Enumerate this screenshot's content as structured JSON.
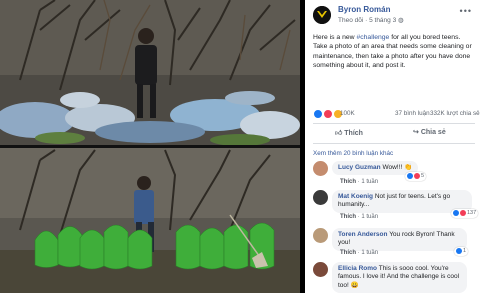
{
  "post": {
    "author": "Byron Román",
    "follow_label": "Theo dõi",
    "date": "5 tháng 3",
    "text_before": "Here is a new ",
    "hashtag": "#challenge",
    "text_after": " for all you bored teens. Take a photo of an area that needs some cleaning or maintenance, then take a photo after you have done something about it, and post it.",
    "reaction_count": "100K",
    "comments_count": "37 bình luận",
    "shares_count": "332K lượt chia sẻ",
    "like_label": "Thích",
    "share_label": "Chia sẻ",
    "more_comments": "Xem thêm 20 bình luận khác"
  },
  "comments": [
    {
      "name": "Lucy Guzman",
      "text": "Wow!!! 👏",
      "like": "Thích",
      "time": "1 tuần",
      "badge": "5"
    },
    {
      "name": "Mat Koenig",
      "text": "Not just for teens. Let's go humanity...",
      "like": "Thích",
      "time": "1 tuần",
      "badge": "137"
    },
    {
      "name": "Toren Anderson",
      "text": "You rock Byron! Thank you!",
      "like": "Thích",
      "time": "1 tuần",
      "badge": "1"
    },
    {
      "name": "Ellicia Romo",
      "text": "This is sooo cool. You're famous. I love it! And the challenge is cool too! 😀",
      "like": "",
      "time": "",
      "badge": ""
    }
  ],
  "colors": {
    "link": "#365899",
    "like_blue": "#1877f2",
    "love_red": "#f33e58",
    "haha_yellow": "#f7b125",
    "bag_green": "#3fae3a"
  },
  "icons": [
    "menu-dots-icon",
    "like-icon",
    "love-icon",
    "haha-icon",
    "thumbs-up-icon",
    "share-icon",
    "logo-avatar-icon"
  ]
}
